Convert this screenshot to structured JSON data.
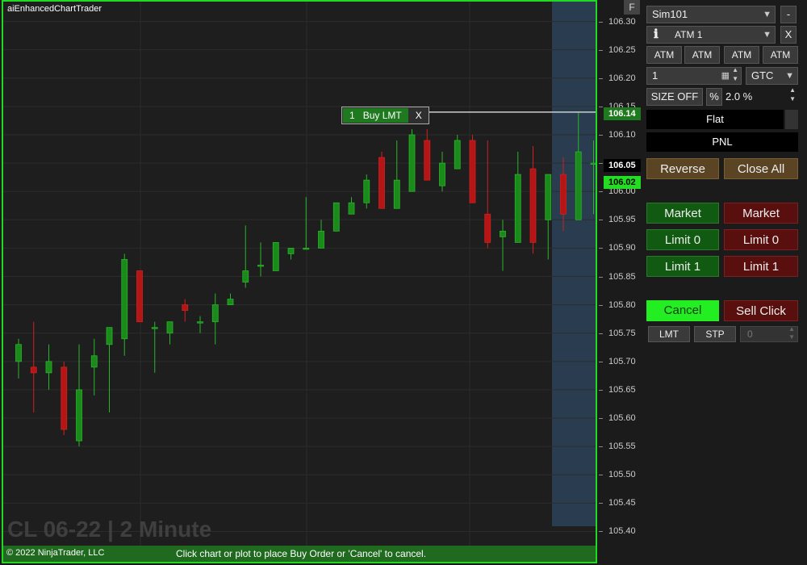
{
  "chart": {
    "title": "aiEnhancedChartTrader",
    "instrument_label": "CL 06-22 | 2 Minute",
    "copyright": "© 2022 NinjaTrader, LLC",
    "status_hint": "Click chart or plot to place Buy Order or 'Cancel' to cancel.",
    "order_tag": {
      "qty": "1",
      "label": "Buy LMT",
      "close": "X"
    },
    "axis_ticks": [
      "106.30",
      "106.25",
      "106.20",
      "106.15",
      "106.10",
      "106.05",
      "106.00",
      "105.95",
      "105.90",
      "105.85",
      "105.80",
      "105.75",
      "105.70",
      "105.65",
      "105.60",
      "105.55",
      "105.50",
      "105.45",
      "105.40"
    ],
    "f_button": "F",
    "price_tags": {
      "order": "106.14",
      "last": "106.05",
      "bid": "106.02"
    },
    "colors": {
      "up": "#1a8a1a",
      "down": "#b51515",
      "frame": "#22d822",
      "highlight": "#2a3f55"
    }
  },
  "chart_data": {
    "type": "candlestick",
    "ylim": [
      105.375,
      106.335
    ],
    "candles": [
      {
        "o": 105.7,
        "h": 105.74,
        "l": 105.67,
        "c": 105.73
      },
      {
        "o": 105.69,
        "h": 105.77,
        "l": 105.61,
        "c": 105.68
      },
      {
        "o": 105.68,
        "h": 105.73,
        "l": 105.65,
        "c": 105.7
      },
      {
        "o": 105.69,
        "h": 105.7,
        "l": 105.57,
        "c": 105.58
      },
      {
        "o": 105.56,
        "h": 105.73,
        "l": 105.55,
        "c": 105.65
      },
      {
        "o": 105.69,
        "h": 105.74,
        "l": 105.64,
        "c": 105.71
      },
      {
        "o": 105.73,
        "h": 105.74,
        "l": 105.61,
        "c": 105.76
      },
      {
        "o": 105.74,
        "h": 105.89,
        "l": 105.71,
        "c": 105.88
      },
      {
        "o": 105.86,
        "h": 105.86,
        "l": 105.77,
        "c": 105.77
      },
      {
        "o": 105.76,
        "h": 105.77,
        "l": 105.68,
        "c": 105.76
      },
      {
        "o": 105.75,
        "h": 105.77,
        "l": 105.73,
        "c": 105.77
      },
      {
        "o": 105.8,
        "h": 105.81,
        "l": 105.77,
        "c": 105.79
      },
      {
        "o": 105.77,
        "h": 105.78,
        "l": 105.75,
        "c": 105.77
      },
      {
        "o": 105.77,
        "h": 105.82,
        "l": 105.73,
        "c": 105.8
      },
      {
        "o": 105.8,
        "h": 105.82,
        "l": 105.8,
        "c": 105.81
      },
      {
        "o": 105.84,
        "h": 105.94,
        "l": 105.83,
        "c": 105.86
      },
      {
        "o": 105.87,
        "h": 105.91,
        "l": 105.85,
        "c": 105.87
      },
      {
        "o": 105.86,
        "h": 105.91,
        "l": 105.86,
        "c": 105.91
      },
      {
        "o": 105.89,
        "h": 105.9,
        "l": 105.88,
        "c": 105.9
      },
      {
        "o": 105.9,
        "h": 105.99,
        "l": 105.9,
        "c": 105.9
      },
      {
        "o": 105.9,
        "h": 105.95,
        "l": 105.9,
        "c": 105.93
      },
      {
        "o": 105.93,
        "h": 105.98,
        "l": 105.93,
        "c": 105.98
      },
      {
        "o": 105.96,
        "h": 105.99,
        "l": 105.96,
        "c": 105.98
      },
      {
        "o": 105.98,
        "h": 106.03,
        "l": 105.97,
        "c": 106.02
      },
      {
        "o": 106.06,
        "h": 106.07,
        "l": 105.97,
        "c": 105.97
      },
      {
        "o": 105.97,
        "h": 106.09,
        "l": 105.97,
        "c": 106.02
      },
      {
        "o": 106.0,
        "h": 106.11,
        "l": 106.0,
        "c": 106.1
      },
      {
        "o": 106.09,
        "h": 106.11,
        "l": 106.02,
        "c": 106.02
      },
      {
        "o": 106.01,
        "h": 106.07,
        "l": 106.0,
        "c": 106.05
      },
      {
        "o": 106.04,
        "h": 106.1,
        "l": 106.04,
        "c": 106.09
      },
      {
        "o": 106.09,
        "h": 106.1,
        "l": 105.98,
        "c": 105.98
      },
      {
        "o": 105.96,
        "h": 106.09,
        "l": 105.9,
        "c": 105.91
      },
      {
        "o": 105.92,
        "h": 105.95,
        "l": 105.86,
        "c": 105.93
      },
      {
        "o": 105.91,
        "h": 106.07,
        "l": 105.91,
        "c": 106.03
      },
      {
        "o": 106.04,
        "h": 106.08,
        "l": 105.89,
        "c": 105.91
      },
      {
        "o": 105.95,
        "h": 106.03,
        "l": 105.88,
        "c": 106.03
      },
      {
        "o": 106.03,
        "h": 106.06,
        "l": 105.93,
        "c": 105.96
      },
      {
        "o": 105.95,
        "h": 106.14,
        "l": 105.95,
        "c": 106.07
      },
      {
        "o": 106.05,
        "h": 106.09,
        "l": 105.96,
        "c": 106.05
      }
    ]
  },
  "panel": {
    "account": "Sim101",
    "minus": "-",
    "info_icon": "info-icon",
    "atm": "ATM 1",
    "atm_close": "X",
    "atm_buttons": [
      "ATM",
      "ATM",
      "ATM",
      "ATM"
    ],
    "qty": "1",
    "tif": "GTC",
    "size_off": "SIZE OFF",
    "pct": "%",
    "pct_value": "2.0 %",
    "position": "Flat",
    "pnl": "PNL",
    "reverse": "Reverse",
    "close_all": "Close All",
    "buy_market": "Market",
    "sell_market": "Market",
    "buy_limit0": "Limit 0",
    "sell_limit0": "Limit 0",
    "buy_limit1": "Limit 1",
    "sell_limit1": "Limit 1",
    "cancel": "Cancel",
    "sell_click": "Sell Click",
    "lmt": "LMT",
    "stp": "STP",
    "offset": "0"
  }
}
